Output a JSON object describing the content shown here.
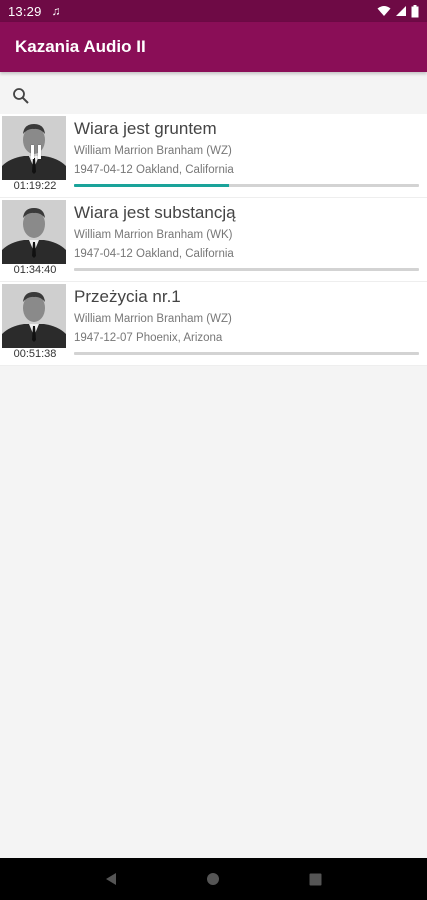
{
  "status_bar": {
    "time": "13:29",
    "icons": [
      "music-note-icon",
      "wifi-icon",
      "signal-icon",
      "battery-icon"
    ]
  },
  "app_bar": {
    "title": "Kazania Audio II"
  },
  "search": {
    "icon": "search-icon"
  },
  "sermons": [
    {
      "title": "Wiara jest gruntem",
      "author": "William Marrion Branham (WZ)",
      "place": "1947-04-12 Oakland, California",
      "duration": "01:19:22",
      "progress": 0.45,
      "playing": true
    },
    {
      "title": "Wiara jest substancją",
      "author": "William Marrion Branham (WK)",
      "place": "1947-04-12 Oakland, California",
      "duration": "01:34:40",
      "progress": 0,
      "playing": false
    },
    {
      "title": "Przeżycia nr.1",
      "author": "William Marrion Branham (WZ)",
      "place": "1947-12-07 Phoenix, Arizona",
      "duration": "00:51:38",
      "progress": 0,
      "playing": false
    }
  ],
  "colors": {
    "status_bar": "#6e0a45",
    "app_bar": "#8a0e57",
    "progress_fill": "#1aa39a",
    "progress_track": "#d3d3d3"
  },
  "nav": {
    "back_icon": "back-icon",
    "home_icon": "home-icon",
    "recents_icon": "recents-icon"
  }
}
